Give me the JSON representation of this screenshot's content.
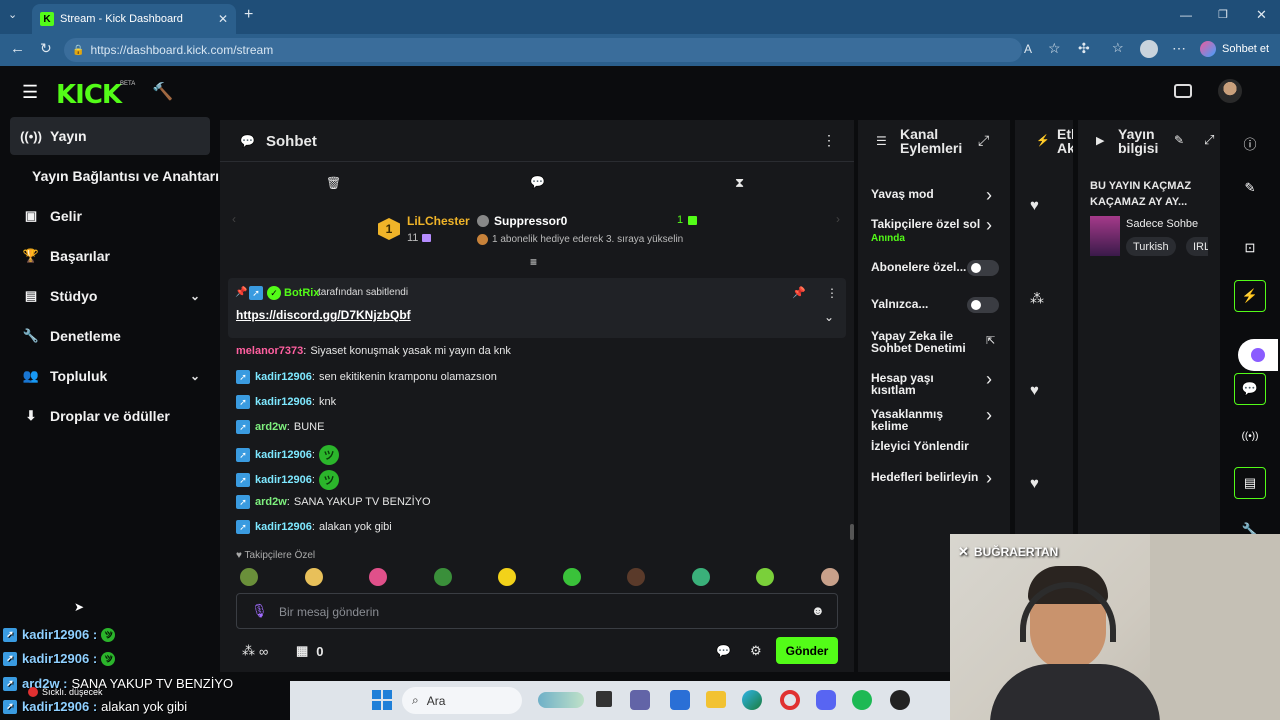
{
  "browser": {
    "tab_title": "Stream - Kick Dashboard",
    "url": "https://dashboard.kick.com/stream",
    "copilot_label": "Sohbet et"
  },
  "header": {
    "logo": "KICK",
    "beta": "BETA"
  },
  "sidebar": {
    "items": [
      {
        "label": "Yayın",
        "icon": "broadcast-icon"
      },
      {
        "label": "Yayın Bağlantısı ve Anahtarı",
        "icon": ""
      },
      {
        "label": "Gelir",
        "icon": "wallet-icon"
      },
      {
        "label": "Başarılar",
        "icon": "trophy-icon"
      },
      {
        "label": "Stüdyo",
        "icon": "studio-icon"
      },
      {
        "label": "Denetleme",
        "icon": "wrench-icon"
      },
      {
        "label": "Topluluk",
        "icon": "people-icon"
      },
      {
        "label": "Droplar ve ödüller",
        "icon": "drops-icon"
      }
    ]
  },
  "chat": {
    "title": "Sohbet",
    "top_user": {
      "name": "LiLChester",
      "count": "11",
      "rank": "1"
    },
    "top_gifter": {
      "name": "Suppressor0",
      "count": "1",
      "note": "1 abonelik hediye ederek 3. sıraya yükselin"
    },
    "pinned": {
      "by": "BotRix",
      "by_suffix": "tarafından sabitlendi",
      "link": "https://discord.gg/D7KNjzbQbf"
    },
    "messages": [
      {
        "user": "melanor7373",
        "text": "Siyaset konuşmak yasak mi yayın da knk",
        "color": "#ff5fa0",
        "badge": false,
        "emote": false
      },
      {
        "user": "kadir12906",
        "text": "sen ekitikenin kramponu olamazsıon",
        "color": "#7ee8ff",
        "badge": true,
        "emote": false
      },
      {
        "user": "kadir12906",
        "text": "knk",
        "color": "#7ee8ff",
        "badge": true,
        "emote": false
      },
      {
        "user": "ard2w",
        "text": "BUNE",
        "color": "#7ef07e",
        "badge": true,
        "emote": false
      },
      {
        "user": "kadir12906",
        "text": "",
        "color": "#7ee8ff",
        "badge": true,
        "emote": true
      },
      {
        "user": "kadir12906",
        "text": "",
        "color": "#7ee8ff",
        "badge": true,
        "emote": true
      },
      {
        "user": "ard2w",
        "text": "SANA YAKUP TV BENZİYO",
        "color": "#7ef07e",
        "badge": true,
        "emote": false
      },
      {
        "user": "kadir12906",
        "text": "alakan yok gibi",
        "color": "#7ee8ff",
        "badge": true,
        "emote": false
      }
    ],
    "followers_only": "Takipçilere Özel",
    "input_placeholder": "Bir mesaj gönderin",
    "points": "∞",
    "store_count": "0",
    "send_label": "Gönder"
  },
  "channel_actions": {
    "title_line1": "Kanal",
    "title_line2": "Eylemleri",
    "items": [
      {
        "label": "Yavaş mod",
        "type": "chevron"
      },
      {
        "label": "Takipçilere özel sol",
        "sub": "Anında",
        "type": "chevron"
      },
      {
        "label": "Abonelere özel...",
        "type": "toggle"
      },
      {
        "label": "Yalnızca...",
        "type": "toggle"
      },
      {
        "label": "Yapay Zeka ile\nSohbet Denetimi",
        "type": "external"
      },
      {
        "label": "Hesap yaşı kısıtlam",
        "type": "chevron"
      },
      {
        "label": "Yasaklanmış kelime",
        "type": "chevron"
      },
      {
        "label": "İzleyici Yönlendir",
        "type": "none"
      },
      {
        "label": "Hedefleri belirleyin",
        "type": "chevron"
      }
    ]
  },
  "activity": {
    "title_line1": "Etk",
    "title_line2": "Ak"
  },
  "stream_info": {
    "title_line1": "Yayın",
    "title_line2": "bilgisi",
    "stream_title": "BU YAYIN KAÇMAZ KAÇAMAZ AY AY...",
    "category": "Sadece Sohbe",
    "tags": [
      "Turkish",
      "IRL"
    ]
  },
  "webcam": {
    "name": "BUĞRAERTAN"
  },
  "overlay": {
    "lines": [
      {
        "user": "kadir12906 :",
        "text": ""
      },
      {
        "user": "kadir12906 :",
        "text": ""
      },
      {
        "user": "ard2w :",
        "text": "SANA YAKUP TV BENZİYO"
      },
      {
        "user": "kadir12906 :",
        "text": "alakan yok gibi"
      }
    ],
    "notification": "Sıcklı. düşecek"
  },
  "taskbar": {
    "search": "Ara"
  }
}
